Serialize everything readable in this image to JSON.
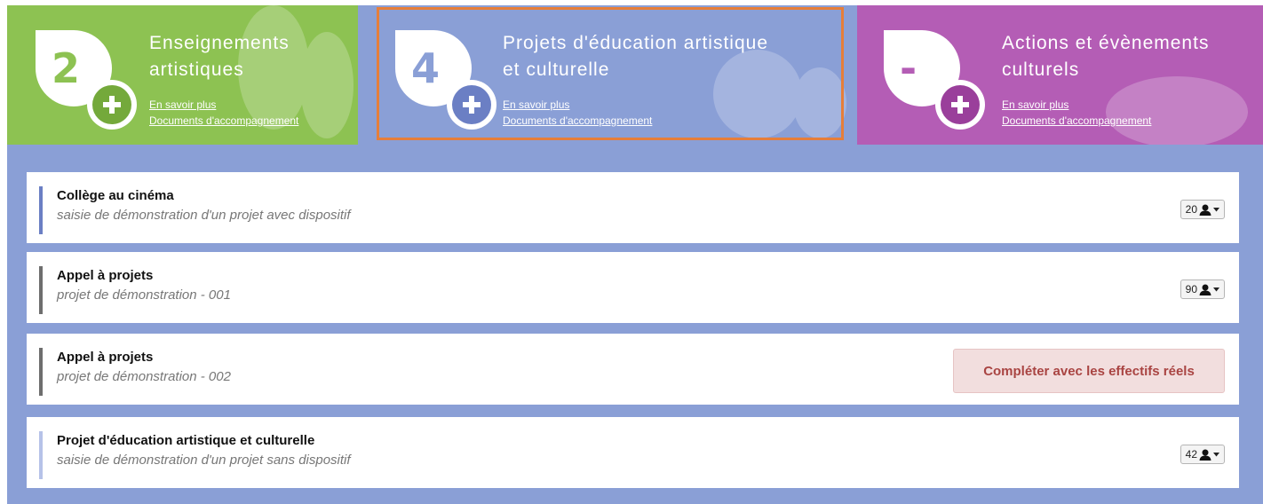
{
  "tiles": [
    {
      "number": "2",
      "title_line1": "Enseignements",
      "title_line2": "artistiques",
      "link1": "En savoir plus",
      "link2": "Documents d'accompagnement",
      "color": "#8dc252",
      "accent": "#74a93b"
    },
    {
      "number": "4",
      "title_line1": "Projets d'éducation artistique",
      "title_line2": "et culturelle",
      "link1": "En savoir plus",
      "link2": "Documents d'accompagnement",
      "color": "#8a9fd6",
      "accent": "#6b7fc4"
    },
    {
      "number": "-",
      "title_line1": "Actions et évènements",
      "title_line2": "culturels",
      "link1": "En savoir plus",
      "link2": "Documents d'accompagnement",
      "color": "#b45db5",
      "accent": "#9a3f9b"
    }
  ],
  "projects": [
    {
      "name": "Collège au cinéma",
      "subtitle": "saisie de démonstration d'un projet avec dispositif",
      "count": "20",
      "bar_color": "#6b7fc4"
    },
    {
      "name": "Appel à projets",
      "subtitle": "projet de démonstration - 001",
      "count": "90",
      "bar_color": "#6e6e6e"
    },
    {
      "name": "Appel à projets",
      "subtitle": "projet de démonstration - 002",
      "action": "Compléter avec les effectifs réels",
      "bar_color": "#6e6e6e"
    },
    {
      "name": "Projet d'éducation artistique et culturelle",
      "subtitle": "saisie de démonstration d'un projet sans dispositif",
      "count": "42",
      "bar_color": "#b6c2e8"
    }
  ]
}
